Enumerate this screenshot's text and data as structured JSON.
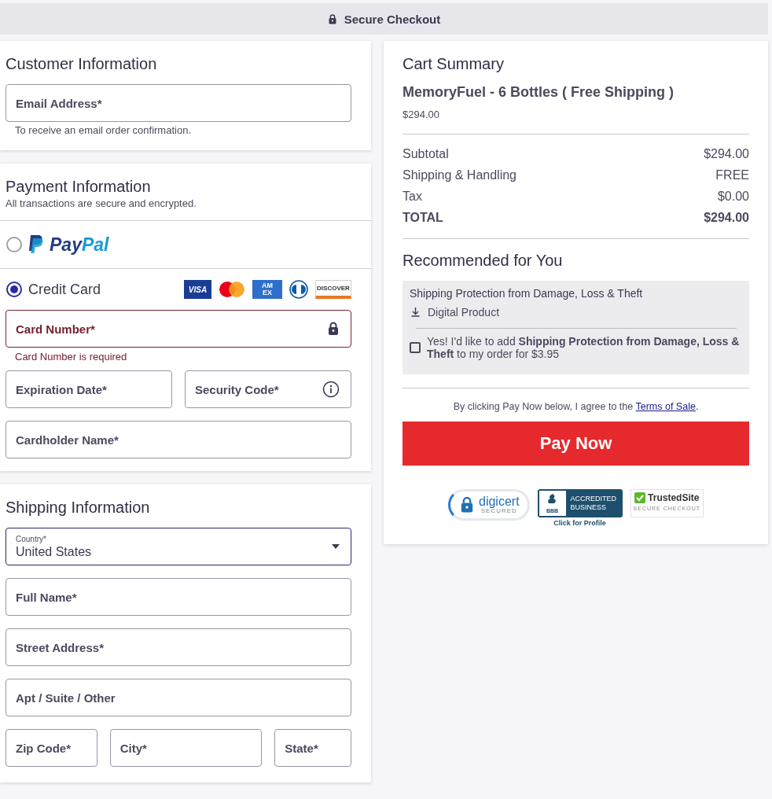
{
  "header": {
    "title": "Secure Checkout"
  },
  "customer": {
    "title": "Customer Information",
    "fields": [
      {
        "label": "Email Address*",
        "hint": "To receive an email order confirmation."
      }
    ]
  },
  "payment": {
    "title": "Payment Information",
    "subtitle": "All transactions are secure and encrypted.",
    "methods": [
      {
        "kind": "paypal",
        "selected": false,
        "logo": [
          "Pay",
          "Pal"
        ]
      },
      {
        "kind": "card",
        "selected": true,
        "label": "Credit Card",
        "brands": [
          {
            "kind": "visa",
            "text": "VISA"
          },
          {
            "kind": "mastercard"
          },
          {
            "kind": "amex",
            "text": "AM EX"
          },
          {
            "kind": "diners"
          },
          {
            "kind": "discover",
            "text": "DISCOVER"
          }
        ]
      }
    ],
    "rows": [
      [
        {
          "kind": "secure",
          "label": "Card Number*",
          "error": true,
          "message": "Card Number is required"
        }
      ],
      [
        {
          "label": "Expiration Date*",
          "error": false
        },
        {
          "kind": "help",
          "label": "Security Code*",
          "error": false
        }
      ],
      [
        {
          "label": "Cardholder Name*",
          "error": false
        }
      ]
    ]
  },
  "shipping": {
    "title": "Shipping Information",
    "country": {
      "label": "Country*",
      "value": "United States"
    },
    "rows": [
      [
        {
          "label": "Full Name*",
          "error": false
        }
      ],
      [
        {
          "label": "Street Address*",
          "error": false
        }
      ],
      [
        {
          "label": "Apt / Suite / Other",
          "error": false
        }
      ],
      [
        {
          "label": "Zip Code*",
          "error": false
        },
        {
          "label": "City*",
          "error": false
        },
        {
          "label": "State*",
          "error": false
        }
      ]
    ]
  },
  "cart": {
    "title": "Cart Summary",
    "product": {
      "name": "MemoryFuel - 6 Bottles ( Free Shipping )",
      "price": "$294.00"
    },
    "lines": [
      {
        "kind": "line",
        "label": "Subtotal",
        "value": "$294.00"
      },
      {
        "kind": "line",
        "label": "Shipping & Handling",
        "value": "FREE"
      },
      {
        "kind": "line",
        "label": "Tax",
        "value": "$0.00"
      },
      {
        "kind": "total",
        "label": "TOTAL",
        "value": "$294.00"
      }
    ],
    "recommended": {
      "title": "Recommended for You",
      "offer": {
        "title": "Shipping Protection from Damage, Loss & Theft",
        "note": "Digital Product",
        "checked": false,
        "text": "Yes! I'd like to add **Shipping Protection from Damage, Loss & Theft** to my order for $3.95"
      }
    },
    "terms": {
      "before": "By clicking Pay Now below, I agree to the ",
      "link": "Terms of Sale",
      "after": "."
    },
    "pay_button": "Pay Now",
    "badges": [
      {
        "kind": "digicert",
        "name": "digicert",
        "sub": "SECURED"
      },
      {
        "kind": "bbb",
        "mark": "BBB",
        "name": "ACCREDITED BUSINESS",
        "sub": "Click for Profile"
      },
      {
        "kind": "trusted",
        "name": "TrustedSite",
        "sub": "SECURE CHECKOUT"
      }
    ]
  }
}
